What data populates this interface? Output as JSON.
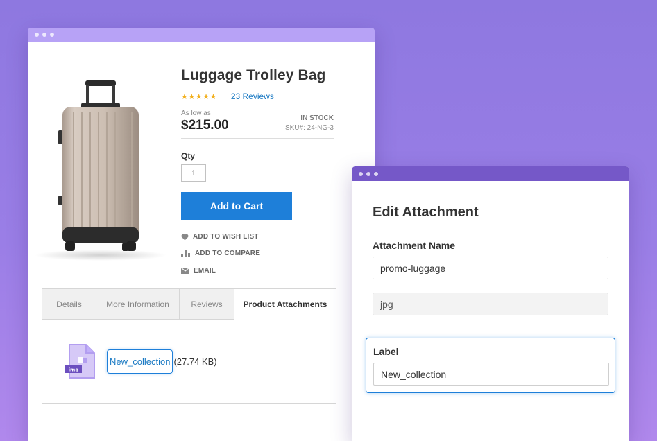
{
  "product": {
    "title": "Luggage Trolley Bag",
    "rating_stars": "★★★★★",
    "rating_value": 5,
    "reviews_link": "23 Reviews",
    "as_low_as": "As low as",
    "price": "$215.00",
    "stock": "IN STOCK",
    "sku": "SKU#: 24-NG-3",
    "qty_label": "Qty",
    "qty_value": "1",
    "add_to_cart": "Add to Cart",
    "actions": {
      "wish": "ADD TO WISH LIST",
      "compare": "ADD TO COMPARE",
      "email": "EMAIL"
    },
    "tabs": [
      {
        "label": "Details"
      },
      {
        "label": "More Information"
      },
      {
        "label": "Reviews"
      },
      {
        "label": "Product Attachments",
        "active": true
      }
    ],
    "attachment": {
      "file_badge": "img",
      "name": "New_collection",
      "size": "(27.74 KB)"
    }
  },
  "edit_attachment": {
    "title": "Edit Attachment",
    "name_label": "Attachment Name",
    "name_value": "promo-luggage",
    "extension_value": "jpg",
    "label_label": "Label",
    "label_value": "New_collection"
  },
  "colors": {
    "accent": "#1e7fd9",
    "star": "#f2b01e",
    "product_titlebar": "#b7a2f6",
    "edit_titlebar": "#7558c8",
    "file_icon": "#c7b6f4",
    "file_badge": "#6c4fbf"
  },
  "icons": [
    "heart-icon",
    "compare-bars-icon",
    "envelope-icon",
    "image-file-icon"
  ]
}
